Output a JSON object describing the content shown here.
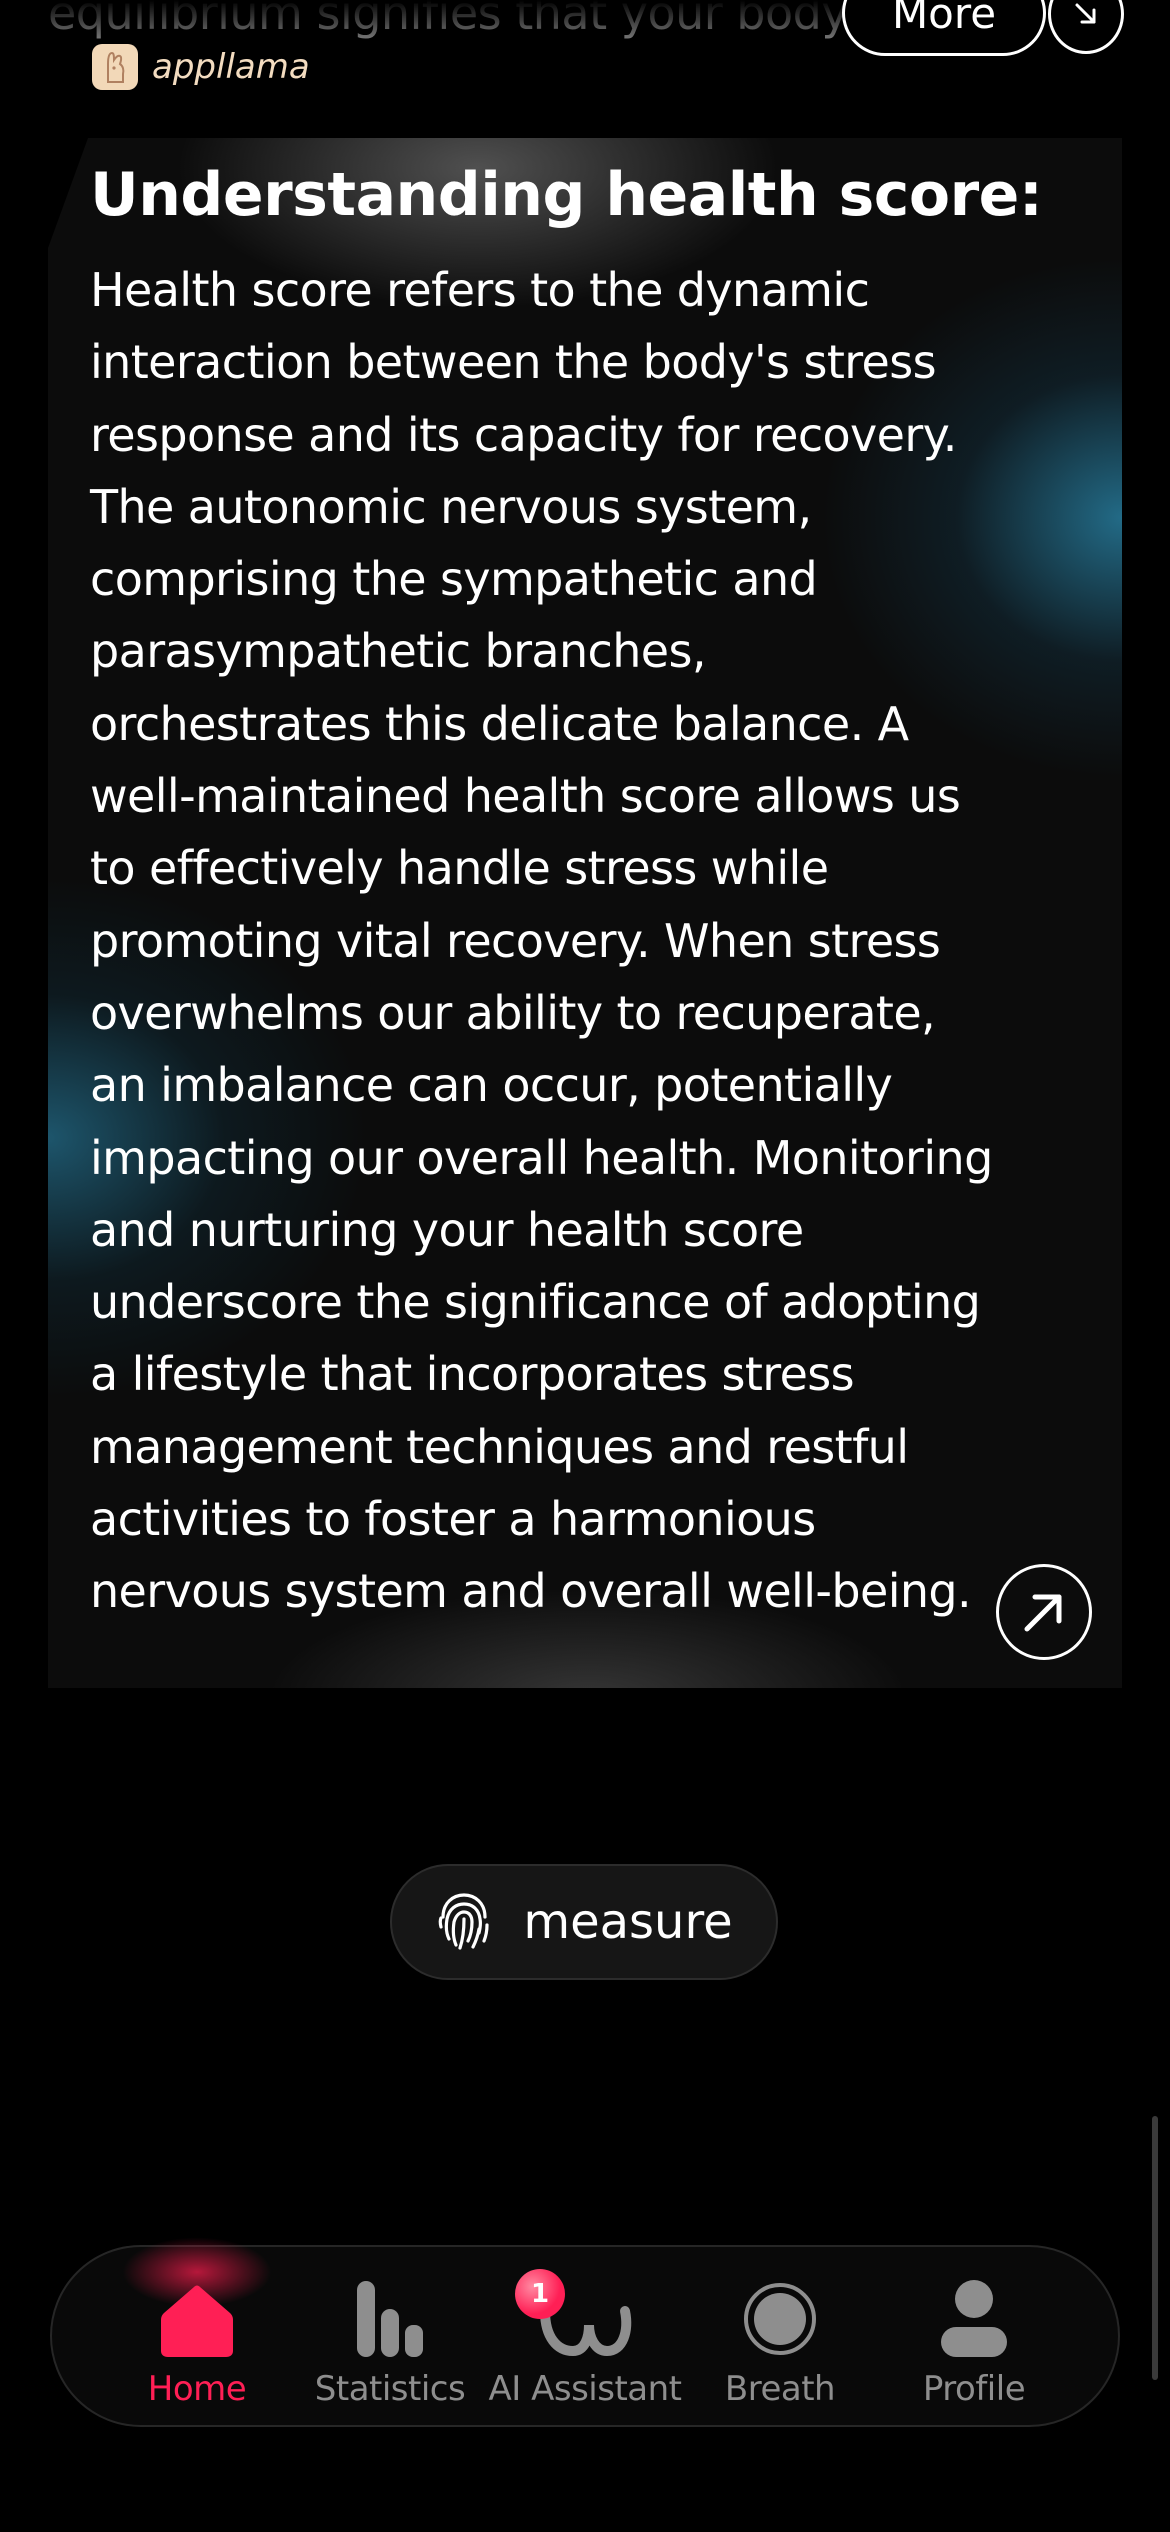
{
  "top": {
    "partial_text": "equilibrium signifies that your body's",
    "more_label": "More",
    "brand_name": "appllama"
  },
  "card": {
    "title": "Understanding health score:",
    "body": "  Health score refers to the dynamic\ninteraction between the body's stress\nresponse and its capacity for recovery.\nThe autonomic nervous system,\ncomprising the sympathetic and\nparasympathetic branches,\norchestrates this delicate balance. A\nwell-maintained health score allows us\nto effectively handle stress while\npromoting vital recovery. When stress\noverwhelms our ability to recuperate,\nan imbalance can occur, potentially\nimpacting our overall health. Monitoring\nand nurturing your health score\nunderscore the significance of adopting\na lifestyle that incorporates stress\nmanagement techniques and restful\nactivities to foster a harmonious\nnervous system and overall well-being."
  },
  "measure": {
    "label": "measure"
  },
  "tabbar": {
    "items": [
      {
        "label": "Home",
        "icon": "home-icon",
        "active": true
      },
      {
        "label": "Statistics",
        "icon": "bar-chart-icon",
        "active": false
      },
      {
        "label": "AI Assistant",
        "icon": "ai-assistant-icon",
        "active": false,
        "badge": "1"
      },
      {
        "label": "Breath",
        "icon": "breath-circle-icon",
        "active": false
      },
      {
        "label": "Profile",
        "icon": "profile-icon",
        "active": false
      }
    ]
  },
  "colors": {
    "accent": "#ff1f55",
    "inactive": "#8e8e8e",
    "background": "#000000",
    "card_teal": "#2882a5"
  }
}
